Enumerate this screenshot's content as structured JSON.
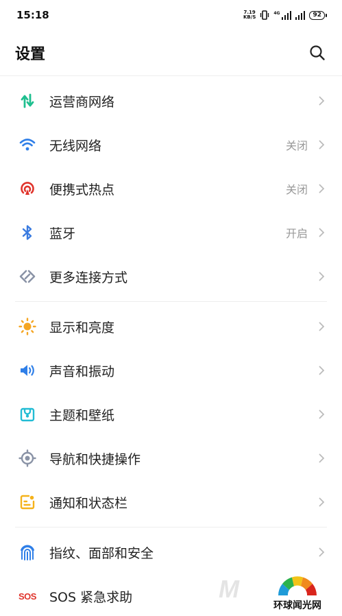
{
  "status_bar": {
    "time": "15:18",
    "net_speed_value": "7.19",
    "net_speed_unit": "KB/S",
    "signal1_label": "4G",
    "battery": "92"
  },
  "header": {
    "title": "设置"
  },
  "sections": [
    {
      "items": [
        {
          "label": "运营商网络",
          "status": "",
          "icon": "mobile-data-icon"
        },
        {
          "label": "无线网络",
          "status": "关闭",
          "icon": "wifi-icon"
        },
        {
          "label": "便携式热点",
          "status": "关闭",
          "icon": "hotspot-icon"
        },
        {
          "label": "蓝牙",
          "status": "开启",
          "icon": "bluetooth-icon"
        },
        {
          "label": "更多连接方式",
          "status": "",
          "icon": "connection-icon"
        }
      ]
    },
    {
      "items": [
        {
          "label": "显示和亮度",
          "status": "",
          "icon": "brightness-icon"
        },
        {
          "label": "声音和振动",
          "status": "",
          "icon": "sound-icon"
        },
        {
          "label": "主题和壁纸",
          "status": "",
          "icon": "theme-icon"
        },
        {
          "label": "导航和快捷操作",
          "status": "",
          "icon": "navigation-icon"
        },
        {
          "label": "通知和状态栏",
          "status": "",
          "icon": "notification-icon"
        }
      ]
    },
    {
      "items": [
        {
          "label": "指纹、面部和安全",
          "status": "",
          "icon": "fingerprint-icon"
        },
        {
          "label": "SOS 紧急求助",
          "status": "",
          "icon": "sos-icon",
          "icon_text": "SOS"
        }
      ]
    }
  ],
  "watermark": {
    "text": "环球闻光网",
    "letter": "M"
  },
  "colors": {
    "mobile_data": "#1fbf8f",
    "wifi": "#2f7fe8",
    "hotspot": "#e0332b",
    "bluetooth": "#3a7be0",
    "connection": "#8a93a6",
    "brightness": "#f5a623",
    "sound": "#2f7fe8",
    "theme": "#22bcd4",
    "navigation": "#8a93a6",
    "notification": "#f5b21b",
    "fingerprint": "#2f7fe8",
    "sos": "#e0332b"
  }
}
